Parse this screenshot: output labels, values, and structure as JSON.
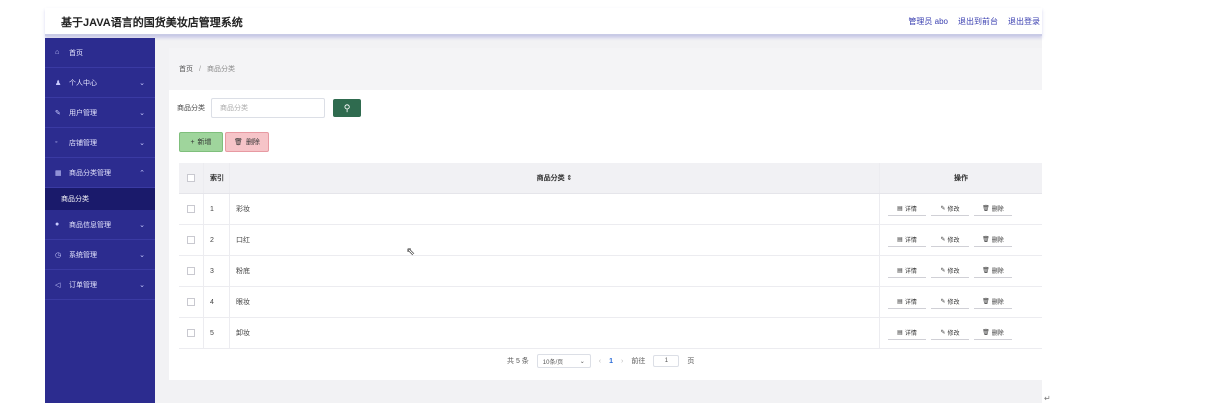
{
  "header": {
    "title": "基于JAVA语言的国货美妆店管理系统",
    "links": [
      "管理员 abo",
      "退出到前台",
      "退出登录"
    ]
  },
  "sidebar": {
    "items": [
      {
        "label": "首页",
        "icon": "home-icon",
        "glyph": "⌂",
        "chevron": ""
      },
      {
        "label": "个人中心",
        "icon": "user-icon",
        "glyph": "♟",
        "chevron": "⌄"
      },
      {
        "label": "用户管理",
        "icon": "thumb-icon",
        "glyph": "✎",
        "chevron": "⌄"
      },
      {
        "label": "店铺管理",
        "icon": "bulb-icon",
        "glyph": "◦",
        "chevron": "⌄"
      },
      {
        "label": "商品分类管理",
        "icon": "grid-icon",
        "glyph": "▦",
        "chevron": "⌃"
      },
      {
        "label": "商品信息管理",
        "icon": "location-icon",
        "glyph": "●",
        "chevron": "⌄"
      },
      {
        "label": "系统管理",
        "icon": "clock-icon",
        "glyph": "◷",
        "chevron": "⌄"
      },
      {
        "label": "订单管理",
        "icon": "send-icon",
        "glyph": "◁",
        "chevron": "⌄"
      }
    ],
    "active_sub": "商品分类"
  },
  "breadcrumb": {
    "home": "首页",
    "separator": "/",
    "current": "商品分类"
  },
  "search": {
    "label": "商品分类",
    "placeholder": "商品分类",
    "button_glyph": "⚲"
  },
  "actions": {
    "add_label": "新增",
    "add_glyph": "+",
    "delete_label": "删除",
    "delete_glyph": "🗑"
  },
  "table": {
    "headers": {
      "index": "索引",
      "name": "商品分类 ⇕",
      "ops": "操作"
    },
    "rows": [
      {
        "index": "1",
        "name": "彩妆"
      },
      {
        "index": "2",
        "name": "口红"
      },
      {
        "index": "3",
        "name": "粉底"
      },
      {
        "index": "4",
        "name": "眼妆"
      },
      {
        "index": "5",
        "name": "卸妆"
      }
    ],
    "op_labels": {
      "detail": "详情",
      "edit": "修改",
      "delete": "删除"
    },
    "op_glyphs": {
      "detail": "▤",
      "edit": "✎",
      "delete": "🗑"
    }
  },
  "pagination": {
    "total": "共 5 条",
    "page_size": "10条/页",
    "prev": "‹",
    "page": "1",
    "next": "›",
    "goto_label": "前往",
    "goto_value": "1",
    "page_suffix": "页"
  },
  "colors": {
    "sidebar": "#2c2c8f",
    "search_button": "#2f6b4f",
    "add_button": "#9fd59c",
    "delete_button": "#f6c4c8"
  }
}
